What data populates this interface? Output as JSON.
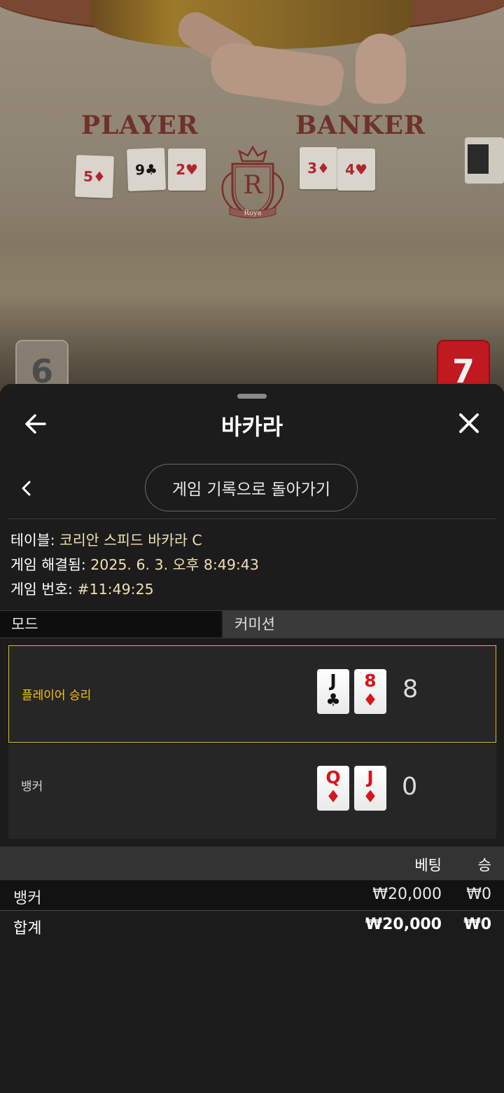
{
  "video": {
    "felt_left": "PLAYER",
    "felt_right": "BANKER",
    "crest_letter": "R",
    "crest_word": "Roya",
    "player_score": "6",
    "banker_score": "7",
    "table_cards_player": [
      {
        "rank": "5",
        "suit": "♦",
        "color": "red"
      },
      {
        "rank": "9",
        "suit": "♣",
        "color": "black"
      },
      {
        "rank": "2",
        "suit": "♥",
        "color": "red"
      }
    ],
    "table_cards_banker": [
      {
        "rank": "3",
        "suit": "♦",
        "color": "red"
      },
      {
        "rank": "4",
        "suit": "♥",
        "color": "red"
      }
    ]
  },
  "sheet": {
    "title": "바카라",
    "back_icon": "arrow-left-icon",
    "close_icon": "close-icon",
    "return_button": "게임 기록으로 돌아가기",
    "info": {
      "table_label": "테이블:",
      "table_value": "코리안 스피드 바카라 C",
      "resolved_label": "게임 해결됨:",
      "resolved_value": "2025. 6. 3. 오후 8:49:43",
      "game_no_label": "게임 번호:",
      "game_no_value": "#11:49:25"
    },
    "mode": {
      "col1": "모드",
      "col2": "커미션"
    },
    "results": [
      {
        "label": "플레이어 승리",
        "cards": [
          {
            "rank": "J",
            "suit": "♣",
            "color": "black"
          },
          {
            "rank": "8",
            "suit": "♦",
            "color": "red"
          }
        ],
        "score": "8",
        "winner": true
      },
      {
        "label": "뱅커",
        "cards": [
          {
            "rank": "Q",
            "suit": "♦",
            "color": "red"
          },
          {
            "rank": "J",
            "suit": "♦",
            "color": "red"
          }
        ],
        "score": "0",
        "winner": false
      }
    ],
    "bets": {
      "headers": {
        "bet": "베팅",
        "win": "승"
      },
      "rows": [
        {
          "name": "뱅커",
          "bet": "₩20,000",
          "win": "₩0"
        },
        {
          "name": "합계",
          "bet": "₩20,000",
          "win": "₩0"
        }
      ]
    }
  },
  "colors": {
    "winner_accent": "#e2bb1a",
    "info_value": "#f2dfb4",
    "banker_red": "#c0191f"
  }
}
